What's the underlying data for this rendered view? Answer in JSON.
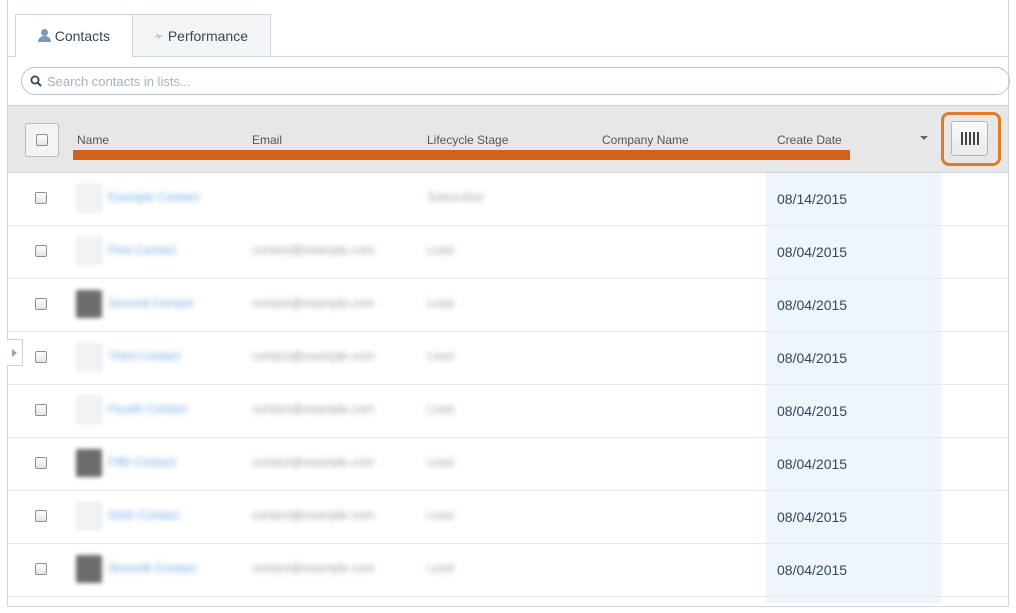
{
  "tabs": [
    {
      "label": "Contacts",
      "icon": "person-icon",
      "active": true
    },
    {
      "label": "Performance",
      "icon": "pulse-icon",
      "active": false
    }
  ],
  "search": {
    "placeholder": "Search contacts in lists..."
  },
  "table": {
    "columns": [
      "Name",
      "Email",
      "Lifecycle Stage",
      "Company Name",
      "Create Date"
    ],
    "sorted_column": "Create Date",
    "rows": [
      {
        "name": "Example Contact",
        "email": "",
        "stage": "Subscriber",
        "date": "08/14/2015",
        "avatar": "placeholder"
      },
      {
        "name": "First Contact",
        "email": "contact@example.com",
        "stage": "Lead",
        "date": "08/04/2015",
        "avatar": "placeholder"
      },
      {
        "name": "Second Contact",
        "email": "contact@example.com",
        "stage": "Lead",
        "date": "08/04/2015",
        "avatar": "photo"
      },
      {
        "name": "Third Contact",
        "email": "contact@example.com",
        "stage": "Lead",
        "date": "08/04/2015",
        "avatar": "placeholder"
      },
      {
        "name": "Fourth Contact",
        "email": "contact@example.com",
        "stage": "Lead",
        "date": "08/04/2015",
        "avatar": "placeholder"
      },
      {
        "name": "Fifth Contact",
        "email": "contact@example.com",
        "stage": "Lead",
        "date": "08/04/2015",
        "avatar": "photo"
      },
      {
        "name": "Sixth Contact",
        "email": "contact@example.com",
        "stage": "Lead",
        "date": "08/04/2015",
        "avatar": "placeholder"
      },
      {
        "name": "Seventh Contact",
        "email": "contact@example.com",
        "stage": "Lead",
        "date": "08/04/2015",
        "avatar": "photo"
      }
    ]
  },
  "colors": {
    "highlight": "#e07b2a",
    "annotation_bar": "#d1641c",
    "link": "#6aa6df",
    "date_column_bg": "#eef5fd"
  },
  "icons": {
    "search": "search-icon",
    "columns": "column-settings-icon",
    "sort": "sort-caret-icon",
    "expand": "expand-arrow-icon"
  }
}
